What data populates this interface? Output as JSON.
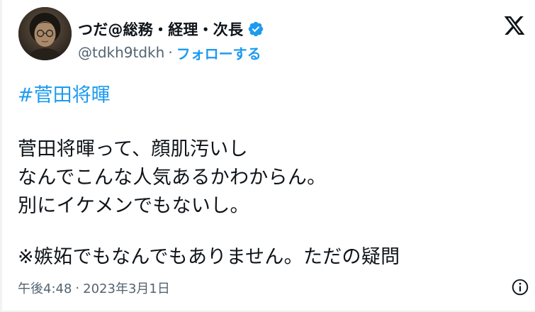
{
  "author": {
    "display_name": "つだ@総務・経理・次長",
    "handle": "@tdkh9tdkh",
    "separator": "·",
    "follow_label": "フォローする",
    "verified": true,
    "avatar_icon": "user-avatar-portrait"
  },
  "brand": {
    "logo_icon": "x-logo-icon"
  },
  "tweet": {
    "hashtag": "#菅田将暉",
    "lines": [
      "菅田将暉って、顔肌汚いし",
      "なんでこんな人気あるかわからん。",
      "別にイケメンでもないし。",
      "※嫉妬でもなんでもありません。ただの疑問"
    ]
  },
  "meta": {
    "time": "午後4:48",
    "separator": "·",
    "date": "2023年3月1日",
    "info_icon": "info-icon"
  },
  "colors": {
    "link_blue": "#1d9bf0",
    "text_primary": "#0f1419",
    "text_secondary": "#536471",
    "verified_blue": "#1d9bf0"
  }
}
